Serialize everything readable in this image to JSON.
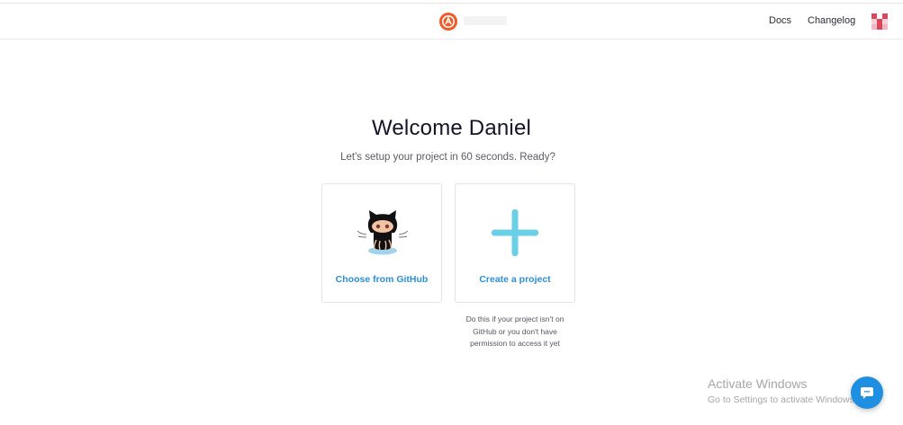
{
  "header": {
    "logo_icon": "rocket-logo-icon",
    "nav": {
      "docs": "Docs",
      "changelog": "Changelog"
    },
    "avatar_icon": "user-avatar-icon"
  },
  "main": {
    "title": "Welcome Daniel",
    "subtitle": "Let's setup your project in 60 seconds. Ready?",
    "cards": {
      "github": {
        "label": "Choose from GitHub",
        "icon": "octocat-icon"
      },
      "create": {
        "label": "Create a project",
        "icon": "plus-icon"
      }
    },
    "create_help": "Do this if your project isn't on GitHub or you don't have permission to access it yet"
  },
  "overlay": {
    "activate_title": "Activate Windows",
    "activate_sub": "Go to Settings to activate Windows."
  },
  "chat": {
    "icon": "chat-bubble-icon"
  },
  "colors": {
    "accent": "#2d8fd5",
    "logo": "#f05a28",
    "plus": "#6ad0e6",
    "chat": "#1e8fe1"
  }
}
